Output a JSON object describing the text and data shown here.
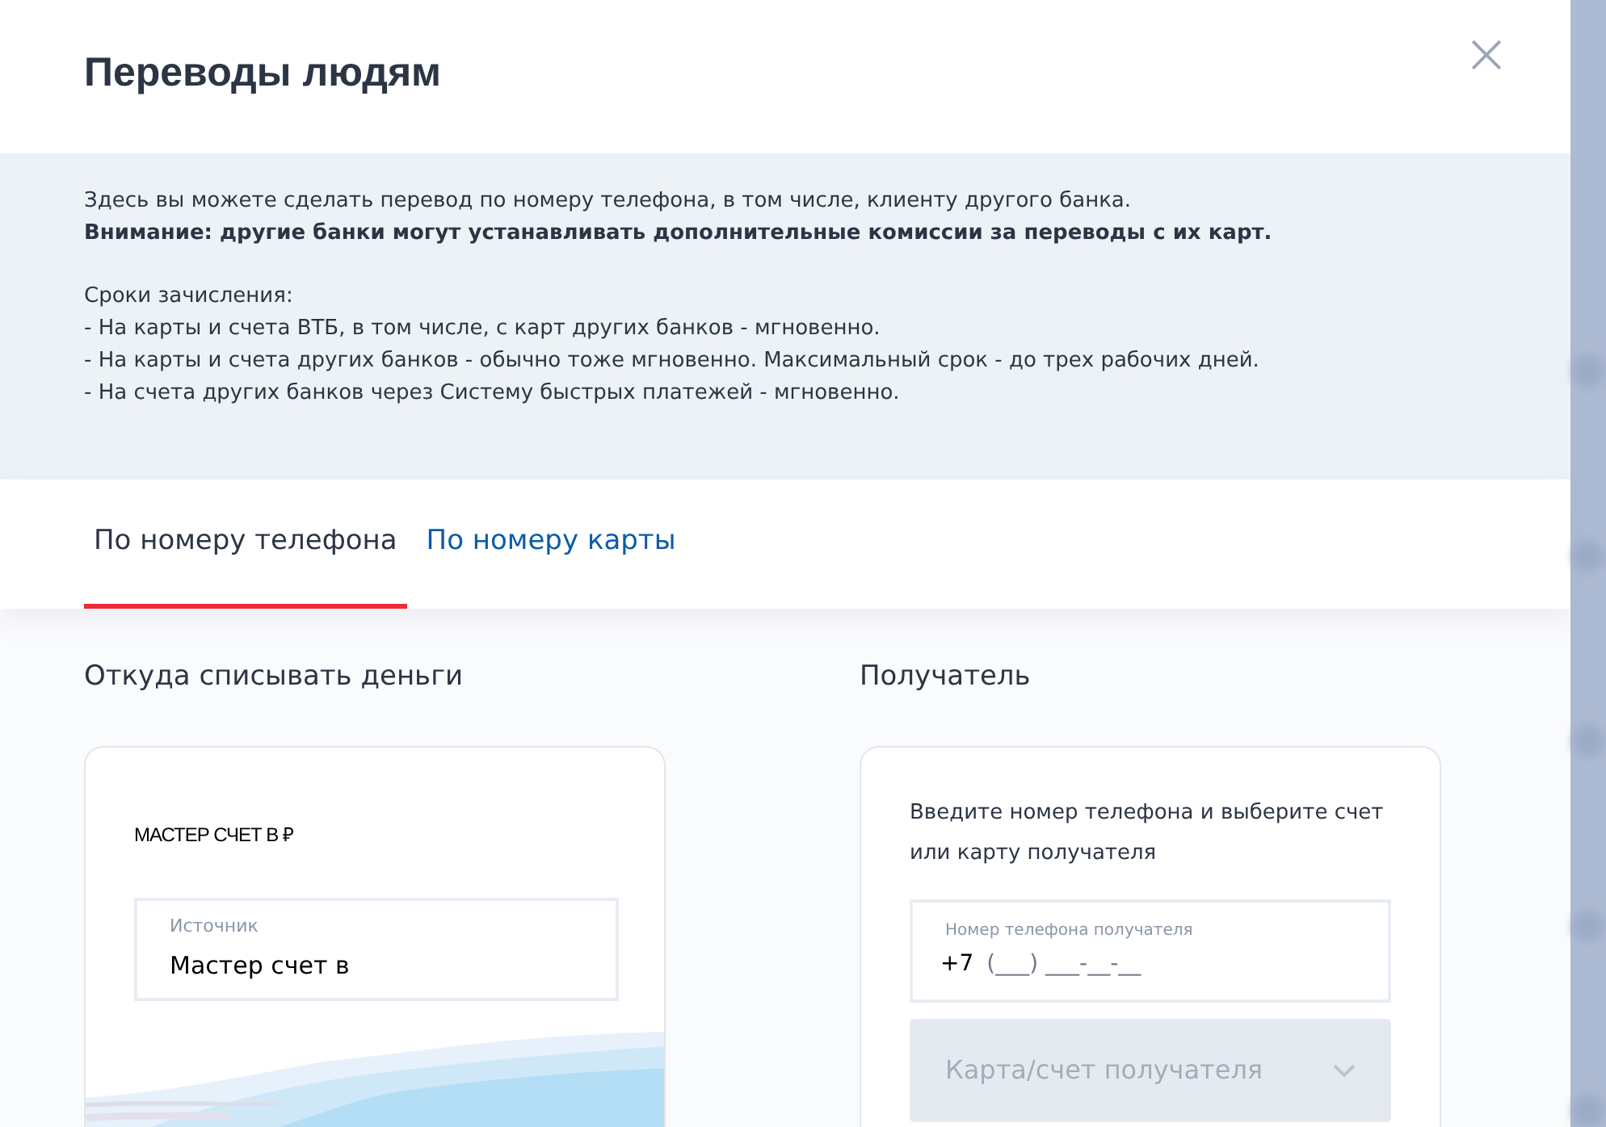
{
  "dialog": {
    "title": "Переводы людям"
  },
  "info": {
    "paragraphs": [
      [
        {
          "text": "Здесь вы можете сделать перевод по номеру телефона, в том числе, клиенту другого банка.",
          "bold": false
        },
        {
          "text": "Внимание: другие банки могут устанавливать дополнительные комиссии за переводы с их карт.",
          "bold": true
        }
      ],
      [
        {
          "text": "Сроки зачисления:",
          "bold": false
        },
        {
          "text": "- На карты и счета ВТБ, в том числе, с карт других банков - мгновенно.",
          "bold": false
        },
        {
          "text": "- На карты и счета других банков - обычно тоже мгновенно. Максимальный срок - до трех рабочих дней.",
          "bold": false
        },
        {
          "text": "- На счета других банков через Систему быстрых платежей - мгновенно.",
          "bold": false
        }
      ]
    ]
  },
  "tabs": [
    {
      "label": "По номеру телефона",
      "selected": true
    },
    {
      "label": "По номеру карты",
      "selected": false
    }
  ],
  "source": {
    "heading": "Откуда списывать деньги",
    "card_title": "МАСТЕР СЧЕТ В ₽",
    "field": {
      "label": "Источник",
      "value": "Мастер счет в"
    }
  },
  "recipient": {
    "heading": "Получатель",
    "hint": "Введите номер телефона и выберите счет или карту получателя",
    "phone": {
      "label": "Номер телефона получателя",
      "value": "+7",
      "mask": "(___) ___-__-__"
    },
    "select": {
      "placeholder": "Карта/счет получателя",
      "disabled": true
    }
  }
}
